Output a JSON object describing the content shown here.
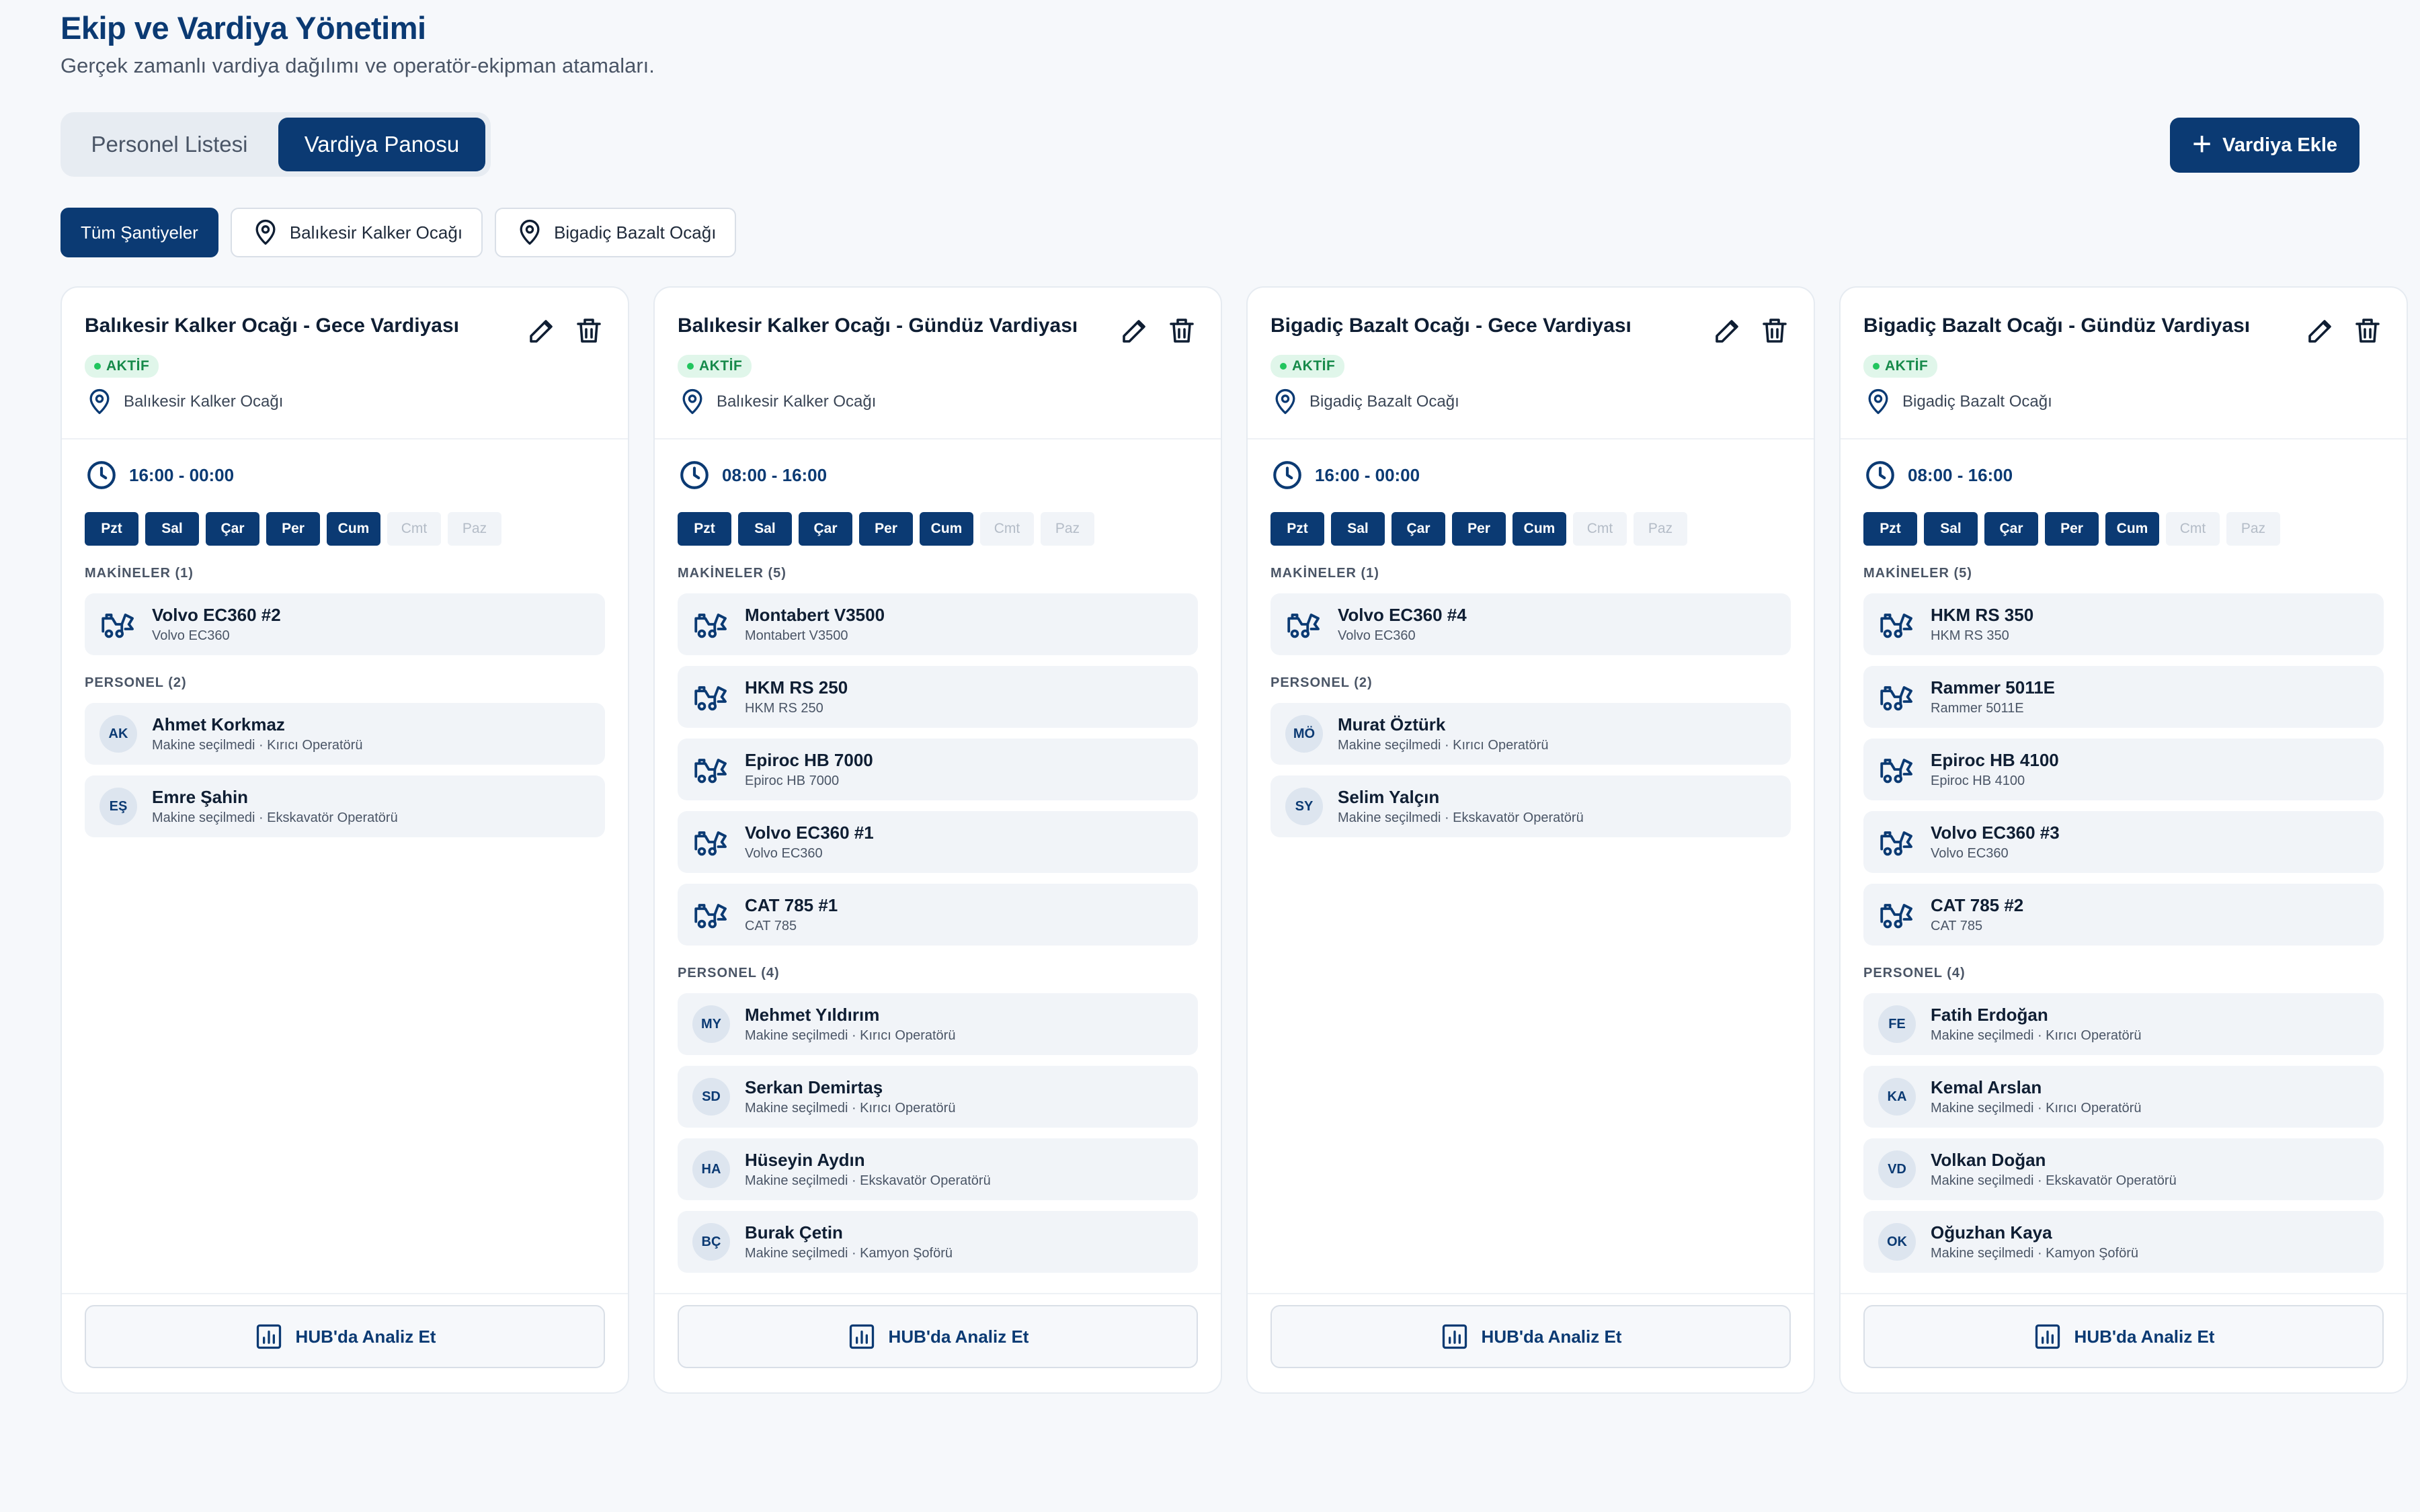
{
  "header": {
    "title": "Ekip ve Vardiya Yönetimi",
    "subtitle": "Gerçek zamanlı vardiya dağılımı ve operatör-ekipman atamaları."
  },
  "tabs": [
    {
      "label": "Personel Listesi",
      "active": false
    },
    {
      "label": "Vardiya Panosu",
      "active": true
    }
  ],
  "add_button": {
    "label": "Vardiya Ekle",
    "icon": "plus-icon"
  },
  "filters": [
    {
      "label": "Tüm Şantiyeler",
      "active": true,
      "icon": ""
    },
    {
      "label": "Balıkesir Kalker Ocağı",
      "active": false,
      "icon": "map-pin-icon"
    },
    {
      "label": "Bigadiç Bazalt Ocağı",
      "active": false,
      "icon": "map-pin-icon"
    }
  ],
  "colors": {
    "primary": "#0b3a73",
    "active_badge": "#22c55e",
    "background": "#f6f8fb"
  },
  "day_labels": [
    "Pzt",
    "Sal",
    "Çar",
    "Per",
    "Cum",
    "Cmt",
    "Paz"
  ],
  "cards": [
    {
      "title": "Balıkesir Kalker Ocağı - Gece Vardiyası",
      "status": "AKTİF",
      "site": "Balıkesir Kalker Ocağı",
      "time": "16:00 - 00:00",
      "active_days": [
        true,
        true,
        true,
        true,
        true,
        false,
        false
      ],
      "machines_label": "MAKİNELER (1)",
      "machines": [
        {
          "name": "Volvo EC360 #2",
          "model": "Volvo EC360"
        }
      ],
      "personnel_label": "PERSONEL (2)",
      "personnel": [
        {
          "initials": "AK",
          "name": "Ahmet Korkmaz",
          "detail": "Makine seçilmedi · Kırıcı Operatörü"
        },
        {
          "initials": "EŞ",
          "name": "Emre Şahin",
          "detail": "Makine seçilmedi · Ekskavatör Operatörü"
        }
      ],
      "hub_label": "HUB'da Analiz Et"
    },
    {
      "title": "Balıkesir Kalker Ocağı - Gündüz Vardiyası",
      "status": "AKTİF",
      "site": "Balıkesir Kalker Ocağı",
      "time": "08:00 - 16:00",
      "active_days": [
        true,
        true,
        true,
        true,
        true,
        false,
        false
      ],
      "machines_label": "MAKİNELER (5)",
      "machines": [
        {
          "name": "Montabert V3500",
          "model": "Montabert V3500"
        },
        {
          "name": "HKM RS 250",
          "model": "HKM RS 250"
        },
        {
          "name": "Epiroc HB 7000",
          "model": "Epiroc HB 7000"
        },
        {
          "name": "Volvo EC360 #1",
          "model": "Volvo EC360"
        },
        {
          "name": "CAT 785 #1",
          "model": "CAT 785"
        }
      ],
      "personnel_label": "PERSONEL (4)",
      "personnel": [
        {
          "initials": "MY",
          "name": "Mehmet Yıldırım",
          "detail": "Makine seçilmedi · Kırıcı Operatörü"
        },
        {
          "initials": "SD",
          "name": "Serkan Demirtaş",
          "detail": "Makine seçilmedi · Kırıcı Operatörü"
        },
        {
          "initials": "HA",
          "name": "Hüseyin Aydın",
          "detail": "Makine seçilmedi · Ekskavatör Operatörü"
        },
        {
          "initials": "BÇ",
          "name": "Burak Çetin",
          "detail": "Makine seçilmedi · Kamyon Şoförü"
        }
      ],
      "hub_label": "HUB'da Analiz Et"
    },
    {
      "title": "Bigadiç Bazalt Ocağı - Gece Vardiyası",
      "status": "AKTİF",
      "site": "Bigadiç Bazalt Ocağı",
      "time": "16:00 - 00:00",
      "active_days": [
        true,
        true,
        true,
        true,
        true,
        false,
        false
      ],
      "machines_label": "MAKİNELER (1)",
      "machines": [
        {
          "name": "Volvo EC360 #4",
          "model": "Volvo EC360"
        }
      ],
      "personnel_label": "PERSONEL (2)",
      "personnel": [
        {
          "initials": "MÖ",
          "name": "Murat Öztürk",
          "detail": "Makine seçilmedi · Kırıcı Operatörü"
        },
        {
          "initials": "SY",
          "name": "Selim Yalçın",
          "detail": "Makine seçilmedi · Ekskavatör Operatörü"
        }
      ],
      "hub_label": "HUB'da Analiz Et"
    },
    {
      "title": "Bigadiç Bazalt Ocağı - Gündüz Vardiyası",
      "status": "AKTİF",
      "site": "Bigadiç Bazalt Ocağı",
      "time": "08:00 - 16:00",
      "active_days": [
        true,
        true,
        true,
        true,
        true,
        false,
        false
      ],
      "machines_label": "MAKİNELER (5)",
      "machines": [
        {
          "name": "HKM RS 350",
          "model": "HKM RS 350"
        },
        {
          "name": "Rammer 5011E",
          "model": "Rammer 5011E"
        },
        {
          "name": "Epiroc HB 4100",
          "model": "Epiroc HB 4100"
        },
        {
          "name": "Volvo EC360 #3",
          "model": "Volvo EC360"
        },
        {
          "name": "CAT 785 #2",
          "model": "CAT 785"
        }
      ],
      "personnel_label": "PERSONEL (4)",
      "personnel": [
        {
          "initials": "FE",
          "name": "Fatih Erdoğan",
          "detail": "Makine seçilmedi · Kırıcı Operatörü"
        },
        {
          "initials": "KA",
          "name": "Kemal Arslan",
          "detail": "Makine seçilmedi · Kırıcı Operatörü"
        },
        {
          "initials": "VD",
          "name": "Volkan Doğan",
          "detail": "Makine seçilmedi · Ekskavatör Operatörü"
        },
        {
          "initials": "OK",
          "name": "Oğuzhan Kaya",
          "detail": "Makine seçilmedi · Kamyon Şoförü"
        }
      ],
      "hub_label": "HUB'da Analiz Et"
    }
  ]
}
